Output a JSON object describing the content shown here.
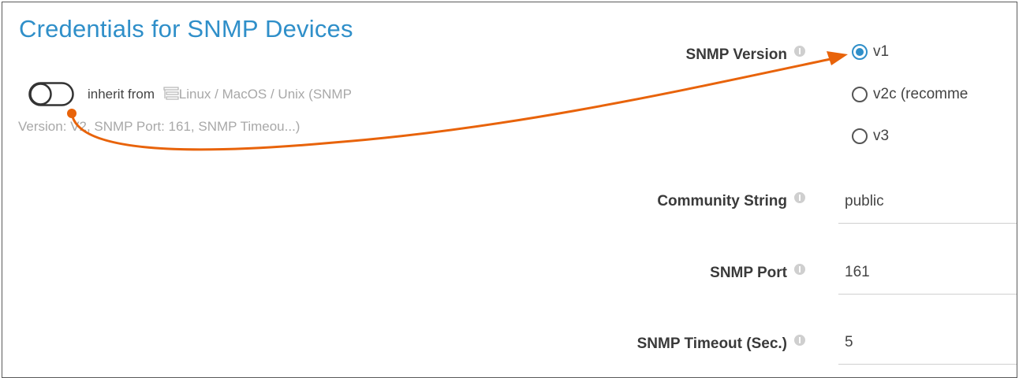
{
  "section": {
    "title": "Credentials for SNMP Devices"
  },
  "inherit": {
    "prefix": "inherit from",
    "source_line1": "Linux / MacOS / Unix (SNMP",
    "source_line2": "Version: V2, SNMP Port: 161, SNMP Timeou...)",
    "toggle_state": "off"
  },
  "snmp_version": {
    "label": "SNMP Version",
    "options": [
      "v1",
      "v2c (recomme",
      "v3"
    ],
    "selected": "v1"
  },
  "community_string": {
    "label": "Community String",
    "value": "public"
  },
  "snmp_port": {
    "label": "SNMP Port",
    "value": "161"
  },
  "snmp_timeout": {
    "label": "SNMP Timeout (Sec.)",
    "value": "5"
  },
  "colors": {
    "accent": "#2f8fc9",
    "annotation_arrow": "#e8630a"
  },
  "icons": {
    "info": "info-icon",
    "device": "device-icon"
  }
}
